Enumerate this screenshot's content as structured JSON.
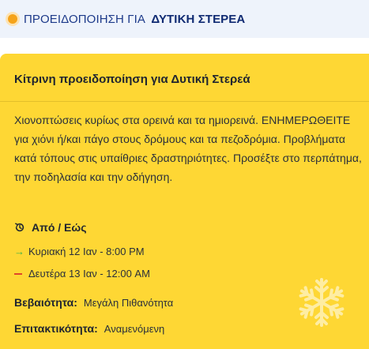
{
  "header": {
    "label": "ΠΡΟΕΙΔΟΠΟΙΗΣΗ ΓΙΑ",
    "region": "ΔΥΤΙΚΗ ΣΤΕΡΕΑ"
  },
  "alert": {
    "title": "Κίτρινη προειδοποίηση για Δυτική Στερεά",
    "description": "Χιονοπτώσεις κυρίως στα ορεινά και τα ημιορεινά. ΕΝΗΜΕΡΩΘΕΙΤΕ για χιόνι ή/και πάγο στους δρόμους και τα πεζοδρόμια. Προβλήματα κατά τόπους στις υπαίθριες δραστηριότητες. Προσέξτε στο περπάτημα, την ποδηλασία και την οδήγηση.",
    "period_label": "Από / Εώς",
    "from": "Κυριακή 12 Ιαν - 8:00 PM",
    "to": "Δευτέρα 13 Ιαν - 12:00 AM",
    "certainty_label": "Βεβαιότητα:",
    "certainty_value": "Μεγάλη Πιθανότητα",
    "urgency_label": "Επιτακτικότητα:",
    "urgency_value": "Αναμενόμενη",
    "icons": {
      "severity": "orange-dot-icon",
      "period": "history-clock-icon",
      "from": "arrow-right-icon",
      "to": "dash-icon",
      "decoration": "snowflake-icon"
    }
  },
  "colors": {
    "card_background": "#fed734",
    "header_background": "#eef3fb",
    "header_text": "#1d3a8a",
    "severity_dot": "#f5a31a",
    "from_arrow": "#3ab24a",
    "to_dash": "#e0452b"
  }
}
